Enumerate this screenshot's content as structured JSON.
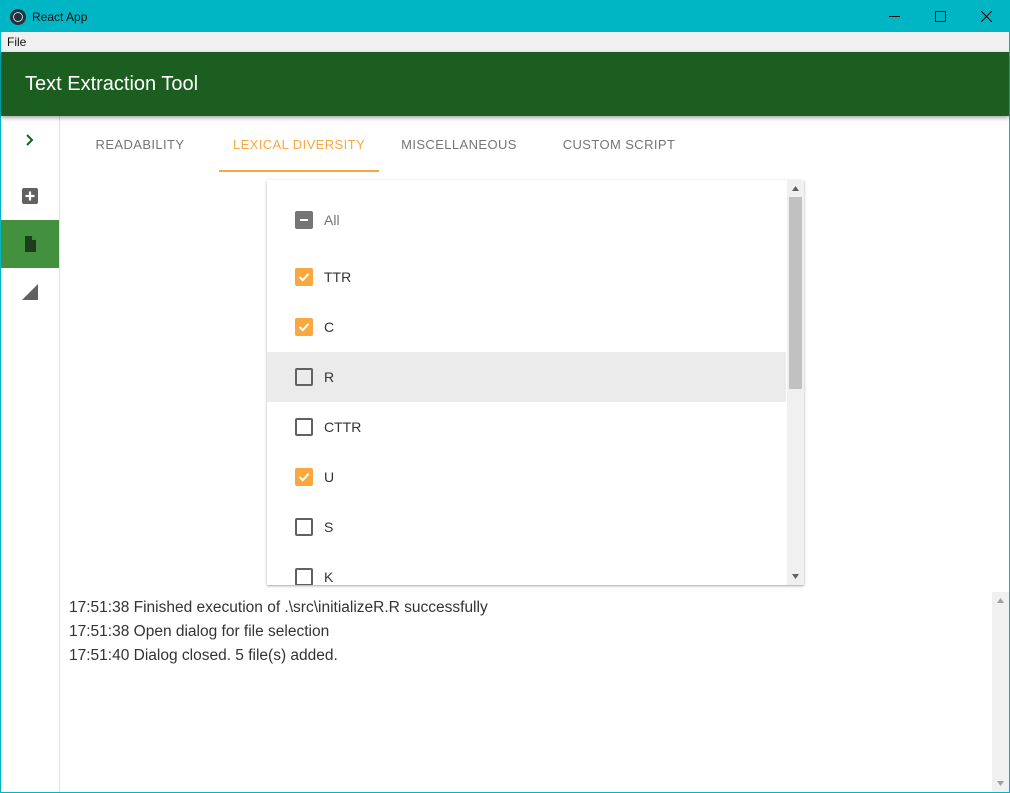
{
  "window": {
    "title": "React App",
    "icon": "electron-icon",
    "controls": [
      "minimize-icon",
      "maximize-icon",
      "close-icon"
    ]
  },
  "menu": {
    "items": [
      {
        "label": "File"
      }
    ]
  },
  "appbar": {
    "title": "Text Extraction Tool",
    "color": "#1b5e20"
  },
  "sidebar": {
    "items": [
      {
        "icon": "chevron-right-icon",
        "active": false
      },
      {
        "icon": "add-box-icon",
        "active": false
      },
      {
        "icon": "file-icon",
        "active": true
      },
      {
        "icon": "signal-triangle-icon",
        "active": false
      }
    ],
    "active_color": "#43913f"
  },
  "tabs": [
    {
      "label": "READABILITY",
      "active": false
    },
    {
      "label": "LEXICAL DIVERSITY",
      "active": true
    },
    {
      "label": "MISCELLANEOUS",
      "active": false
    },
    {
      "label": "CUSTOM SCRIPT",
      "active": false
    }
  ],
  "accent_color": "#f9a73e",
  "checklist": {
    "all": {
      "label": "All",
      "state": "indeterminate"
    },
    "items": [
      {
        "label": "TTR",
        "checked": true
      },
      {
        "label": "C",
        "checked": true
      },
      {
        "label": "R",
        "checked": false,
        "hovered": true
      },
      {
        "label": "CTTR",
        "checked": false
      },
      {
        "label": "U",
        "checked": true
      },
      {
        "label": "S",
        "checked": false
      },
      {
        "label": "K",
        "checked": false
      }
    ]
  },
  "log": {
    "lines": [
      "17:51:38 Finished execution of .\\src\\initializeR.R successfully",
      "17:51:38 Open dialog for file selection",
      "17:51:40 Dialog closed. 5 file(s) added."
    ]
  }
}
